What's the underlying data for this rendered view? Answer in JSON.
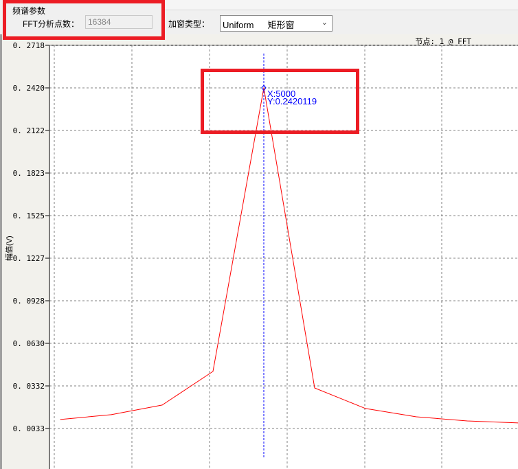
{
  "params": {
    "group_title": "频谱参数",
    "fft_label": "FFT分析点数：",
    "fft_value": "16384",
    "window_label": "加窗类型：",
    "window_value_en": "Uniform",
    "window_value_cn": "矩形窗"
  },
  "node_status": "节点: 1 @ FFT",
  "annotation_color": "#ec1c24",
  "chart_data": {
    "type": "line",
    "ylabel": "幅值(V)",
    "yticks": [
      "0.2718",
      "0.2420",
      "0.2122",
      "0.1823",
      "0.1525",
      "0.1227",
      "0.0928",
      "0.0630",
      "0.0332",
      "0.0033"
    ],
    "ylim": [
      -0.0265,
      0.2718
    ],
    "grid": true,
    "series_color": "#ff0000",
    "cursor_color": "#0000ff",
    "x": [
      4996,
      4997,
      4998,
      4999,
      5000,
      5001,
      5002,
      5003,
      5004,
      5005
    ],
    "y": [
      0.0096,
      0.013,
      0.0197,
      0.0433,
      0.2420119,
      0.0317,
      0.0173,
      0.0115,
      0.0086,
      0.0072
    ],
    "cursor": {
      "x": 5000,
      "x_label": "X:5000",
      "y_label": "Y:0.2420119"
    }
  }
}
